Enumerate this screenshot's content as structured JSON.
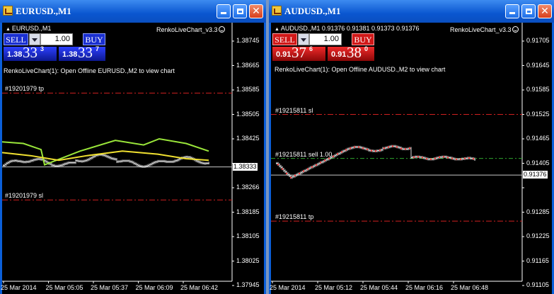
{
  "windows": [
    {
      "title": "EURUSD.,M1",
      "header_text": "EURUSD.,M1",
      "indicator_name": "RenkoLiveChart_v3.3",
      "panel": {
        "sell_label": "SELL",
        "buy_label": "BUY",
        "lot": "1.00",
        "sell_price": {
          "prefix": "1.38",
          "big": "33",
          "sup": "3"
        },
        "buy_price": {
          "prefix": "1.38",
          "big": "33",
          "sup": "7"
        }
      },
      "message": "RenkoLiveChart(1): Open Offline EURUSD.,M2 to view chart",
      "levels": [
        {
          "label": "#19201979 tp",
          "price": 1.38575
        },
        {
          "label": "#19201979 sl",
          "price": 1.38225
        }
      ],
      "y_ticks": [
        "1.38745",
        "1.38665",
        "1.38585",
        "1.38505",
        "1.38425",
        "1.38333",
        "1.38266",
        "1.38185",
        "1.38105",
        "1.38025",
        "1.37945"
      ],
      "current_price": "1.38333",
      "x_ticks": [
        "25 Mar 2014",
        "25 Mar 05:05",
        "25 Mar 05:37",
        "25 Mar 06:09",
        "25 Mar 06:42"
      ],
      "colors": {
        "panel": "#1a2fd0",
        "panel_dark": "#0c1890",
        "level": "#d02020",
        "ma_fast": "#9ae63a",
        "ma_slow": "#f0e030"
      }
    },
    {
      "title": "AUDUSD.,M1",
      "header_text": "AUDUSD.,M1  0.91376 0.91381 0.91373 0.91376",
      "indicator_name": "RenkoLiveChart_v3.3",
      "panel": {
        "sell_label": "SELL",
        "buy_label": "BUY",
        "lot": "1.00",
        "sell_price": {
          "prefix": "0.91",
          "big": "37",
          "sup": "6"
        },
        "buy_price": {
          "prefix": "0.91",
          "big": "38",
          "sup": "0"
        }
      },
      "message": "RenkoLiveChart(1): Open Offline AUDUSD.,M2 to view chart",
      "levels": [
        {
          "label": "#19215811 sl",
          "price": 0.91525
        },
        {
          "label": "#19215811 sell 1.00",
          "price": 0.91417
        },
        {
          "label": "#19215811 tp",
          "price": 0.91263
        }
      ],
      "y_ticks": [
        "0.91705",
        "0.91645",
        "0.91585",
        "0.91525",
        "0.91465",
        "0.91405",
        "0.91376",
        "0.91285",
        "0.91225",
        "0.91165",
        "0.91105"
      ],
      "current_price": "0.91376",
      "x_ticks": [
        "25 Mar 2014",
        "25 Mar 05:12",
        "25 Mar 05:44",
        "25 Mar 06:16",
        "25 Mar 06:48"
      ],
      "colors": {
        "panel": "#d01818",
        "panel_dark": "#8c0808",
        "level": "#d02020",
        "entry": "#2fa82f"
      }
    }
  ]
}
